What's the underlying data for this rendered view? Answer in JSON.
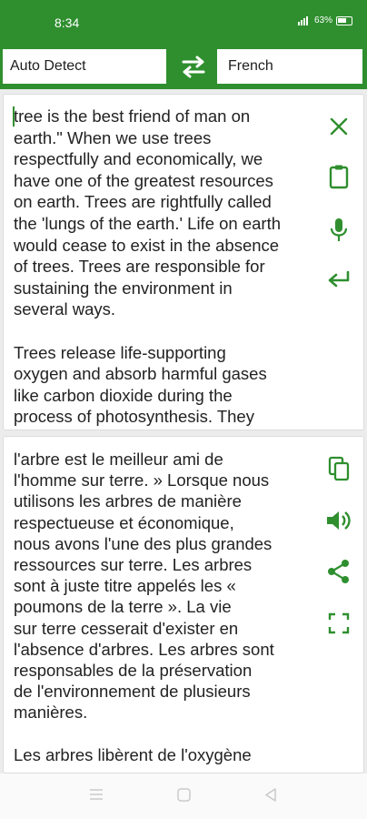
{
  "status_bar": {
    "time": "8:34",
    "battery": "63%"
  },
  "languages": {
    "source": "Auto Detect",
    "target": "French"
  },
  "source_panel": {
    "text": "tree is the best friend of man on\nearth.\" When we use trees\nrespectfully and economically, we\nhave one of the greatest resources\non earth. Trees are rightfully called\nthe 'lungs of the earth.' Life on earth\nwould cease to exist in the absence\nof trees. Trees are responsible for\nsustaining the environment in\nseveral ways.\n\nTrees release life-supporting\noxygen and absorb harmful gases\nlike carbon dioxide during the\nprocess of photosynthesis. They"
  },
  "target_panel": {
    "text": "l'arbre est le meilleur ami de\nl'homme sur terre. » Lorsque nous\nutilisons les arbres de manière\nrespectueuse et économique,\nnous avons l'une des plus grandes\nressources sur terre. Les arbres\nsont à juste titre appelés les «\npoumons de la terre ». La vie\nsur terre cesserait d'exister en\nl'absence d'arbres. Les arbres sont\nresponsables de la préservation\nde l'environnement de plusieurs\nmanières.\n\nLes arbres libèrent de l'oxygène"
  },
  "colors": {
    "accent": "#2f8f2f",
    "text": "#222222",
    "background": "#ececec"
  },
  "icons": [
    "swap-icon",
    "close-icon",
    "clipboard-icon",
    "mic-icon",
    "enter-icon",
    "copy-icon",
    "speaker-icon",
    "share-icon",
    "fullscreen-icon",
    "menu-icon",
    "home-icon",
    "back-icon"
  ]
}
